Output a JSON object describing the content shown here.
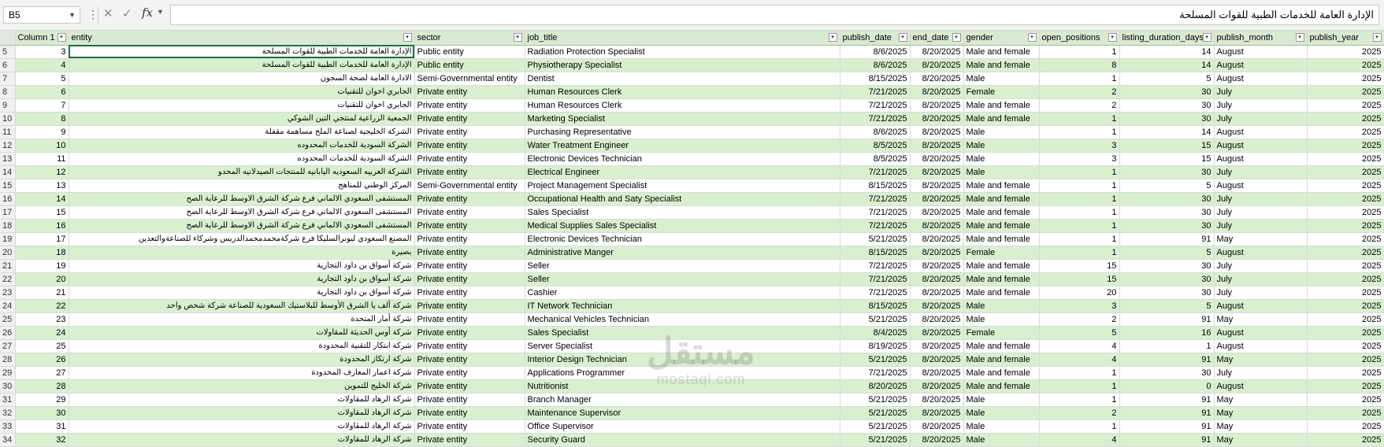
{
  "formula_bar": {
    "name_box": "B5",
    "formula_text": "الإدارة العامة للخدمات الطبية للقوات المسلحة"
  },
  "icons": {
    "cancel": "close-icon",
    "enter": "check-icon",
    "function": "fx-icon",
    "dropdown": "chevron-down-icon",
    "filter": "filter-dropdown-icon"
  },
  "columns": [
    "Column 1",
    "entity",
    "sector",
    "job_title",
    "publish_date",
    "end_date",
    "gender",
    "open_positions",
    "listing_duration_days",
    "publish_month",
    "publish_year"
  ],
  "rows": [
    {
      "row": "5",
      "c1": "3",
      "entity": "الإدارة العامة للخدمات الطبية للقوات المسلحة",
      "sector": "Public entity",
      "job": "Radiation Protection Specialist",
      "pub": "8/6/2025",
      "end": "8/20/2025",
      "gender": "Male and female",
      "open": "1",
      "dur": "14",
      "month": "August",
      "year": "2025"
    },
    {
      "row": "6",
      "c1": "4",
      "entity": "الإدارة العامة للخدمات الطبية للقوات المسلحة",
      "sector": "Public entity",
      "job": "Physiotherapy Specialist",
      "pub": "8/6/2025",
      "end": "8/20/2025",
      "gender": "Male and female",
      "open": "8",
      "dur": "14",
      "month": "August",
      "year": "2025"
    },
    {
      "row": "7",
      "c1": "5",
      "entity": "الادارة العامة لصحة السجون",
      "sector": "Semi-Governmental entity",
      "job": "Dentist",
      "pub": "8/15/2025",
      "end": "8/20/2025",
      "gender": "Male",
      "open": "1",
      "dur": "5",
      "month": "August",
      "year": "2025"
    },
    {
      "row": "8",
      "c1": "6",
      "entity": "الجابري اخوان للتقنيات",
      "sector": "Private entity",
      "job": "Human Resources Clerk",
      "pub": "7/21/2025",
      "end": "8/20/2025",
      "gender": "Female",
      "open": "2",
      "dur": "30",
      "month": "July",
      "year": "2025"
    },
    {
      "row": "9",
      "c1": "7",
      "entity": "الجابري اخوان للتقنيات",
      "sector": "Private entity",
      "job": "Human Resources Clerk",
      "pub": "7/21/2025",
      "end": "8/20/2025",
      "gender": "Male and female",
      "open": "2",
      "dur": "30",
      "month": "July",
      "year": "2025"
    },
    {
      "row": "10",
      "c1": "8",
      "entity": "الجمعية الزراعية لمنتجي التين الشوكي",
      "sector": "Private entity",
      "job": "Marketing Specialist",
      "pub": "7/21/2025",
      "end": "8/20/2025",
      "gender": "Male and female",
      "open": "1",
      "dur": "30",
      "month": "July",
      "year": "2025"
    },
    {
      "row": "11",
      "c1": "9",
      "entity": "الشركة الخليجية لصناعة الملح مساهمة مقفلة",
      "sector": "Private entity",
      "job": "Purchasing Representative",
      "pub": "8/6/2025",
      "end": "8/20/2025",
      "gender": "Male",
      "open": "1",
      "dur": "14",
      "month": "August",
      "year": "2025"
    },
    {
      "row": "12",
      "c1": "10",
      "entity": "الشركة السودية للخدمات المحدوده",
      "sector": "Private entity",
      "job": "Water Treatment Engineer",
      "pub": "8/5/2025",
      "end": "8/20/2025",
      "gender": "Male",
      "open": "3",
      "dur": "15",
      "month": "August",
      "year": "2025"
    },
    {
      "row": "13",
      "c1": "11",
      "entity": "الشركة السودية للخدمات المحدوده",
      "sector": "Private entity",
      "job": "Electronic Devices Technician",
      "pub": "8/5/2025",
      "end": "8/20/2025",
      "gender": "Male",
      "open": "3",
      "dur": "15",
      "month": "August",
      "year": "2025"
    },
    {
      "row": "14",
      "c1": "12",
      "entity": "الشركة العربيه السعوديه اليابانيه للمنتجات الصيدلانيه المحدو",
      "sector": "Private entity",
      "job": "Electrical Engineer",
      "pub": "7/21/2025",
      "end": "8/20/2025",
      "gender": "Male",
      "open": "1",
      "dur": "30",
      "month": "July",
      "year": "2025"
    },
    {
      "row": "15",
      "c1": "13",
      "entity": "المركز الوطني للمناهج",
      "sector": "Semi-Governmental entity",
      "job": "Project Management Specialist",
      "pub": "8/15/2025",
      "end": "8/20/2025",
      "gender": "Male and female",
      "open": "1",
      "dur": "5",
      "month": "August",
      "year": "2025"
    },
    {
      "row": "16",
      "c1": "14",
      "entity": "المستشفى السعودي الالماني فرع شركة الشرق الاوسط للرعاية الصح",
      "sector": "Private entity",
      "job": "Occupational Health and Saty Specialist",
      "pub": "7/21/2025",
      "end": "8/20/2025",
      "gender": "Male and female",
      "open": "1",
      "dur": "30",
      "month": "July",
      "year": "2025"
    },
    {
      "row": "17",
      "c1": "15",
      "entity": "المستشفى السعودي الالماني فرع شركة الشرق الاوسط للرعاية الصح",
      "sector": "Private entity",
      "job": "Sales Specialist",
      "pub": "7/21/2025",
      "end": "8/20/2025",
      "gender": "Male and female",
      "open": "1",
      "dur": "30",
      "month": "July",
      "year": "2025"
    },
    {
      "row": "18",
      "c1": "16",
      "entity": "المستشفى السعودي الالماني فرع شركة الشرق الاوسط للرعاية الصح",
      "sector": "Private entity",
      "job": "Medical Supplies Sales Specialist",
      "pub": "7/21/2025",
      "end": "8/20/2025",
      "gender": "Male and female",
      "open": "1",
      "dur": "30",
      "month": "July",
      "year": "2025"
    },
    {
      "row": "19",
      "c1": "17",
      "entity": "المصنع السعودي ليونرالسليكا فرع شركةمحمدمحمدالدريس وشركاء للصناعةوالتعدين",
      "sector": "Private entity",
      "job": "Electronic Devices Technician",
      "pub": "5/21/2025",
      "end": "8/20/2025",
      "gender": "Male and female",
      "open": "1",
      "dur": "91",
      "month": "May",
      "year": "2025"
    },
    {
      "row": "20",
      "c1": "18",
      "entity": "بصيرة",
      "sector": "Private entity",
      "job": "Administrative Manger",
      "pub": "8/15/2025",
      "end": "8/20/2025",
      "gender": "Female",
      "open": "1",
      "dur": "5",
      "month": "August",
      "year": "2025"
    },
    {
      "row": "21",
      "c1": "19",
      "entity": "شركة أسواق بن داود التجارية",
      "sector": "Private entity",
      "job": "Seller",
      "pub": "7/21/2025",
      "end": "8/20/2025",
      "gender": "Male and female",
      "open": "15",
      "dur": "30",
      "month": "July",
      "year": "2025"
    },
    {
      "row": "22",
      "c1": "20",
      "entity": "شركة أسواق بن داود التجارية",
      "sector": "Private entity",
      "job": "Seller",
      "pub": "7/21/2025",
      "end": "8/20/2025",
      "gender": "Male and female",
      "open": "15",
      "dur": "30",
      "month": "July",
      "year": "2025"
    },
    {
      "row": "23",
      "c1": "21",
      "entity": "شركة أسواق بن داود التجارية",
      "sector": "Private entity",
      "job": "Cashier",
      "pub": "7/21/2025",
      "end": "8/20/2025",
      "gender": "Male and female",
      "open": "20",
      "dur": "30",
      "month": "July",
      "year": "2025"
    },
    {
      "row": "24",
      "c1": "22",
      "entity": "شركة ألف يا الشرق الأوسط للبلاستيك السعودية للصناعة شركة شخص واحد",
      "sector": "Private entity",
      "job": "IT Network Technician",
      "pub": "8/15/2025",
      "end": "8/20/2025",
      "gender": "Male",
      "open": "3",
      "dur": "5",
      "month": "August",
      "year": "2025"
    },
    {
      "row": "25",
      "c1": "23",
      "entity": "شركة أمار المتحدة",
      "sector": "Private entity",
      "job": "Mechanical Vehicles Technician",
      "pub": "5/21/2025",
      "end": "8/20/2025",
      "gender": "Male",
      "open": "2",
      "dur": "91",
      "month": "May",
      "year": "2025"
    },
    {
      "row": "26",
      "c1": "24",
      "entity": "شركة أوس الحديثة للمقاولات",
      "sector": "Private entity",
      "job": "Sales Specialist",
      "pub": "8/4/2025",
      "end": "8/20/2025",
      "gender": "Female",
      "open": "5",
      "dur": "16",
      "month": "August",
      "year": "2025"
    },
    {
      "row": "27",
      "c1": "25",
      "entity": "شركة ابتكار للتقنية المحدودة",
      "sector": "Private entity",
      "job": "Server Specialist",
      "pub": "8/19/2025",
      "end": "8/20/2025",
      "gender": "Male and female",
      "open": "4",
      "dur": "1",
      "month": "August",
      "year": "2025"
    },
    {
      "row": "28",
      "c1": "26",
      "entity": "شركة ارتكاز المحدودة",
      "sector": "Private entity",
      "job": "Interior Design Technician",
      "pub": "5/21/2025",
      "end": "8/20/2025",
      "gender": "Male and female",
      "open": "4",
      "dur": "91",
      "month": "May",
      "year": "2025"
    },
    {
      "row": "29",
      "c1": "27",
      "entity": "شركة اعمار المعارف المحدودة",
      "sector": "Private entity",
      "job": "Applications Programmer",
      "pub": "7/21/2025",
      "end": "8/20/2025",
      "gender": "Male and female",
      "open": "1",
      "dur": "30",
      "month": "July",
      "year": "2025"
    },
    {
      "row": "30",
      "c1": "28",
      "entity": "شركة الخليج للتموين",
      "sector": "Private entity",
      "job": "Nutritionist",
      "pub": "8/20/2025",
      "end": "8/20/2025",
      "gender": "Male and female",
      "open": "1",
      "dur": "0",
      "month": "August",
      "year": "2025"
    },
    {
      "row": "31",
      "c1": "29",
      "entity": "شركة الرهاد للمقاولات",
      "sector": "Private entity",
      "job": "Branch Manager",
      "pub": "5/21/2025",
      "end": "8/20/2025",
      "gender": "Male",
      "open": "1",
      "dur": "91",
      "month": "May",
      "year": "2025"
    },
    {
      "row": "32",
      "c1": "30",
      "entity": "شركة الرهاد للمقاولات",
      "sector": "Private entity",
      "job": "Maintenance Supervisor",
      "pub": "5/21/2025",
      "end": "8/20/2025",
      "gender": "Male",
      "open": "2",
      "dur": "91",
      "month": "May",
      "year": "2025"
    },
    {
      "row": "33",
      "c1": "31",
      "entity": "شركة الرهاد للمقاولات",
      "sector": "Private entity",
      "job": "Office Supervisor",
      "pub": "5/21/2025",
      "end": "8/20/2025",
      "gender": "Male",
      "open": "1",
      "dur": "91",
      "month": "May",
      "year": "2025"
    },
    {
      "row": "34",
      "c1": "32",
      "entity": "شركة الرهاد للمقاولات",
      "sector": "Private entity",
      "job": "Security Guard",
      "pub": "5/21/2025",
      "end": "8/20/2025",
      "gender": "Male",
      "open": "4",
      "dur": "91",
      "month": "May",
      "year": "2025"
    }
  ],
  "watermark": {
    "main": "مستقل",
    "sub": "mostaql.com"
  }
}
